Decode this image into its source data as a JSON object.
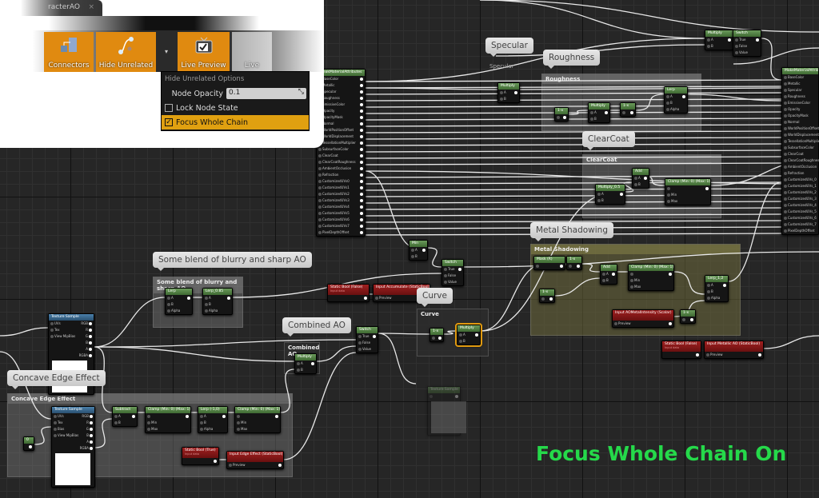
{
  "window": {
    "tab_title": "racterAO",
    "tab_close": "×"
  },
  "toolbar": {
    "buttons": [
      {
        "label": "Connectors",
        "icon": "connectors-icon",
        "active": true
      },
      {
        "label": "Hide Unrelated",
        "icon": "hide-unrelated-icon",
        "active": true
      },
      {
        "label": "Live Preview",
        "icon": "live-preview-icon",
        "active": true
      },
      {
        "label": "Live",
        "icon": "live-nodes-icon",
        "active": false
      }
    ],
    "dropdown_glyph": "▾"
  },
  "menu": {
    "header": "Hide Unrelated Options",
    "opacity_label": "Node Opacity",
    "opacity_value": "0.1",
    "lock_label": "Lock Node State",
    "lock_checked": false,
    "focus_label": "Focus Whole Chain",
    "focus_checked": true,
    "check_glyph": "✓"
  },
  "comments": [
    {
      "title": "Roughness",
      "bubble": "Roughness"
    },
    {
      "title": "ClearCoat",
      "bubble": "ClearCoat"
    },
    {
      "title": "Metal Shadowing",
      "bubble": "Metal Shadowing"
    },
    {
      "title": "Some blend of blurry and sharp AO",
      "bubble": "Some blend of blurry and sharp AO"
    },
    {
      "title": "Curve",
      "bubble": "Curve"
    },
    {
      "title": "Combined AO",
      "bubble": "Combined AO"
    },
    {
      "title": "Concave Edge Effect",
      "bubble": "Concave Edge Effect"
    },
    {
      "title": "Specular",
      "bubble": "Specular"
    }
  ],
  "nodes": [
    {
      "title": "BreakMaterialAttributes",
      "rows": [
        [
          "BaseColor",
          ""
        ],
        [
          "Metallic",
          ""
        ],
        [
          "Specular",
          ""
        ],
        [
          "Roughness",
          ""
        ],
        [
          "EmissiveColor",
          ""
        ],
        [
          "Opacity",
          ""
        ],
        [
          "OpacityMask",
          ""
        ],
        [
          "Normal",
          ""
        ],
        [
          "WorldPositionOffset",
          ""
        ],
        [
          "WorldDisplacement",
          ""
        ],
        [
          "TessellationMultiplier",
          ""
        ],
        [
          "SubsurfaceColor",
          ""
        ],
        [
          "ClearCoat",
          ""
        ],
        [
          "ClearCoatRoughness",
          ""
        ],
        [
          "AmbientOcclusion",
          ""
        ],
        [
          "Refraction",
          ""
        ],
        [
          "CustomizedUVs0",
          ""
        ],
        [
          "CustomizedUVs1",
          ""
        ],
        [
          "CustomizedUVs2",
          ""
        ],
        [
          "CustomizedUVs3",
          ""
        ],
        [
          "CustomizedUVs4",
          ""
        ],
        [
          "CustomizedUVs5",
          ""
        ],
        [
          "CustomizedUVs6",
          ""
        ],
        [
          "CustomizedUVs7",
          ""
        ],
        [
          "PixelDepthOffset",
          ""
        ]
      ]
    },
    {
      "title": "MakeMaterialAttributes",
      "rows": [
        [
          "BaseColor",
          null
        ],
        [
          "Metallic",
          null
        ],
        [
          "Specular",
          null
        ],
        [
          "Roughness",
          null
        ],
        [
          "EmissiveColor",
          null
        ],
        [
          "Opacity",
          null
        ],
        [
          "OpacityMask",
          null
        ],
        [
          "Normal",
          null
        ],
        [
          "WorldPositionOffset",
          null
        ],
        [
          "WorldDisplacement",
          null
        ],
        [
          "TessellationMultiplier",
          null
        ],
        [
          "SubsurfaceColor",
          null
        ],
        [
          "ClearCoat",
          null
        ],
        [
          "ClearCoatRoughness",
          null
        ],
        [
          "AmbientOcclusion",
          null
        ],
        [
          "Refraction",
          null
        ],
        [
          "CustomizedUVs_0",
          null
        ],
        [
          "CustomizedUVs_1",
          null
        ],
        [
          "CustomizedUVs_2",
          null
        ],
        [
          "CustomizedUVs_3",
          null
        ],
        [
          "CustomizedUVs_4",
          null
        ],
        [
          "CustomizedUVs_5",
          null
        ],
        [
          "CustomizedUVs_6",
          null
        ],
        [
          "CustomizedUVs_7",
          null
        ],
        [
          "PixelDepthOffset",
          null
        ]
      ]
    },
    {
      "title": "Multiply",
      "rows": [
        [
          "A",
          ""
        ],
        [
          "B",
          null
        ]
      ]
    },
    {
      "title": "Switch",
      "rows": [
        [
          "True",
          ""
        ],
        [
          "False",
          null
        ],
        [
          "Value",
          null
        ]
      ]
    },
    {
      "title": "Multiply",
      "rows": [
        [
          "A",
          ""
        ],
        [
          "B",
          null
        ]
      ]
    },
    {
      "title": "1-x",
      "rows": [
        [
          "",
          ""
        ]
      ]
    },
    {
      "title": "Multiply",
      "rows": [
        [
          "A",
          ""
        ],
        [
          "B",
          null
        ]
      ]
    },
    {
      "title": "1-x",
      "rows": [
        [
          "",
          ""
        ]
      ]
    },
    {
      "title": "Lerp",
      "rows": [
        [
          "A",
          ""
        ],
        [
          "B",
          null
        ],
        [
          "Alpha",
          null
        ]
      ]
    },
    {
      "title": "Add",
      "rows": [
        [
          "A",
          ""
        ],
        [
          "B",
          null
        ]
      ]
    },
    {
      "title": "Multiply_0.5",
      "rows": [
        [
          "A",
          ""
        ],
        [
          "B",
          null
        ]
      ]
    },
    {
      "title": "Clamp (Min: 0) (Max: 1)",
      "rows": [
        [
          "",
          ""
        ],
        [
          "Min",
          null
        ],
        [
          "Max",
          null
        ]
      ]
    },
    {
      "title": "Mask (R)",
      "rows": [
        [
          "",
          ""
        ]
      ]
    },
    {
      "title": "1-x",
      "rows": [
        [
          "",
          ""
        ]
      ]
    },
    {
      "title": "1-x",
      "rows": [
        [
          "",
          ""
        ]
      ]
    },
    {
      "title": "Add",
      "rows": [
        [
          "A",
          ""
        ],
        [
          "B",
          null
        ]
      ]
    },
    {
      "title": "Clamp (Min: 0) (Max: 1)",
      "rows": [
        [
          "",
          ""
        ],
        [
          "Min",
          null
        ],
        [
          "Max",
          null
        ]
      ]
    },
    {
      "title": "Lerp_1,2",
      "rows": [
        [
          "A",
          ""
        ],
        [
          "B",
          null
        ],
        [
          "Alpha",
          null
        ]
      ]
    },
    {
      "title": "Input AOMetalIntensity (Scalar)",
      "kind": "red",
      "rows": [
        [
          "Preview",
          ""
        ]
      ]
    },
    {
      "title": "1-x",
      "rows": [
        [
          "",
          ""
        ]
      ]
    },
    {
      "title": "Static Bool (False)",
      "subtitle": "Input data",
      "kind": "red",
      "rows": [
        [
          null,
          ""
        ]
      ]
    },
    {
      "title": "Input Metallic AO (StaticBool)",
      "kind": "red",
      "rows": [
        [
          "Preview",
          ""
        ]
      ]
    },
    {
      "title": "Min",
      "rows": [
        [
          "A",
          ""
        ],
        [
          "B",
          null
        ]
      ]
    },
    {
      "title": "Switch",
      "rows": [
        [
          "True",
          ""
        ],
        [
          "False",
          null
        ],
        [
          "Value",
          null
        ]
      ]
    },
    {
      "title": "Static Bool (False)",
      "subtitle": "Input data",
      "kind": "red",
      "rows": [
        [
          null,
          ""
        ]
      ]
    },
    {
      "title": "Input Accumulate (StaticBool)",
      "kind": "red",
      "rows": [
        [
          "Preview",
          ""
        ]
      ]
    },
    {
      "title": "1-x",
      "rows": [
        [
          "",
          ""
        ]
      ]
    },
    {
      "title": "Multiply",
      "selected": true,
      "rows": [
        [
          "A",
          ""
        ],
        [
          "B",
          null
        ]
      ]
    },
    {
      "title": "Switch",
      "rows": [
        [
          "True",
          ""
        ],
        [
          "False",
          null
        ],
        [
          "Value",
          null
        ]
      ]
    },
    {
      "title": "Multiply",
      "rows": [
        [
          "A",
          ""
        ],
        [
          "B",
          null
        ]
      ]
    },
    {
      "title": "Lerp",
      "rows": [
        [
          "A",
          ""
        ],
        [
          "B",
          null
        ],
        [
          "Alpha",
          null
        ]
      ]
    },
    {
      "title": "Lerp_0.85",
      "rows": [
        [
          "A",
          ""
        ],
        [
          "B",
          null
        ],
        [
          "Alpha",
          null
        ]
      ]
    },
    {
      "title": "Texture Sample",
      "kind": "blue",
      "preview": true,
      "rows": [
        [
          "UVs",
          "RGB"
        ],
        [
          "Tex",
          "R"
        ],
        [
          "View MipBias",
          "G"
        ],
        [
          null,
          "B"
        ],
        [
          null,
          "A"
        ],
        [
          null,
          "RGBA"
        ]
      ]
    },
    {
      "title": "Texture Sample",
      "kind": "blue",
      "preview": true,
      "rows": [
        [
          "UVs",
          "RGB"
        ],
        [
          "Tex",
          "R"
        ],
        [
          "Bias",
          "G"
        ],
        [
          "View MipBias",
          "B"
        ],
        [
          null,
          "A"
        ],
        [
          null,
          "RGBA"
        ]
      ]
    },
    {
      "title": "Subtract",
      "rows": [
        [
          "A",
          ""
        ],
        [
          "B",
          null
        ]
      ]
    },
    {
      "title": "Clamp (Min: 0) (Max: 1)",
      "rows": [
        [
          "",
          ""
        ],
        [
          "Min",
          null
        ],
        [
          "Max",
          null
        ]
      ]
    },
    {
      "title": "Lerp (-1,0)",
      "rows": [
        [
          "A",
          ""
        ],
        [
          "B",
          null
        ],
        [
          "Alpha",
          null
        ]
      ]
    },
    {
      "title": "Clamp (Min: 0) (Max: 1)",
      "rows": [
        [
          "",
          ""
        ],
        [
          "Min",
          null
        ],
        [
          "Max",
          null
        ]
      ]
    },
    {
      "title": "0",
      "rows": [
        [
          null,
          ""
        ]
      ]
    },
    {
      "title": "Static Bool (True)",
      "subtitle": "Input data",
      "kind": "red",
      "rows": [
        [
          null,
          ""
        ]
      ]
    },
    {
      "title": "Input Edge Effect (StaticBool)",
      "kind": "red",
      "rows": [
        [
          "Preview",
          ""
        ]
      ]
    },
    {
      "title": "Texture Sample",
      "dim": true,
      "rows": [
        [
          "",
          ""
        ]
      ],
      "preview": true
    }
  ],
  "overlay_caption": "Focus Whole Chain On",
  "colors": {
    "accent": "#e08a10",
    "menu_highlight": "#e0a010",
    "caption": "#25d94a",
    "node_header": "#4f7a40",
    "input_header": "#8b1c1c",
    "texture_header": "#2d5f8a"
  }
}
